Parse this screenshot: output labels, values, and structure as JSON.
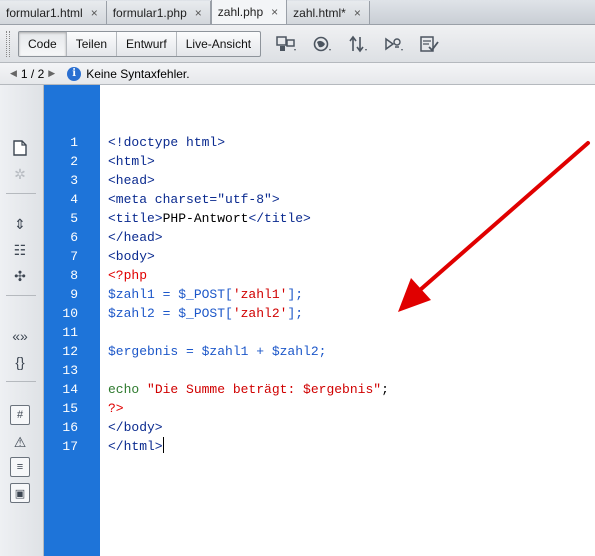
{
  "tabs": [
    {
      "label": "formular1.html",
      "close": "×",
      "active": false
    },
    {
      "label": "formular1.php",
      "close": "×",
      "active": false
    },
    {
      "label": "zahl.php",
      "close": "×",
      "active": true
    },
    {
      "label": "zahl.html*",
      "close": "×",
      "active": false
    }
  ],
  "toolbar": {
    "views": [
      "Code",
      "Teilen",
      "Entwurf",
      "Live-Ansicht"
    ],
    "active_view": "Code",
    "tools": [
      "multiscreen-icon",
      "globe-icon",
      "file-transfer-icon",
      "preview-icon",
      "validate-icon"
    ]
  },
  "nav": {
    "page": "1 / 2",
    "status": "Keine Syntaxfehler."
  },
  "editor": {
    "line_numbers": [
      "1",
      "2",
      "3",
      "4",
      "5",
      "6",
      "7",
      "8",
      "9",
      "10",
      "11",
      "12",
      "13",
      "14",
      "15",
      "16",
      "17"
    ],
    "lines": [
      [
        {
          "t": "<!doctype html>",
          "c": "tag"
        }
      ],
      [
        {
          "t": "<html>",
          "c": "tag"
        }
      ],
      [
        {
          "t": "<head>",
          "c": "tag"
        }
      ],
      [
        {
          "t": "<meta charset=\"utf-8\">",
          "c": "tag"
        }
      ],
      [
        {
          "t": "<title>",
          "c": "tag"
        },
        {
          "t": "PHP-Antwort",
          "c": "plain"
        },
        {
          "t": "</title>",
          "c": "tag"
        }
      ],
      [
        {
          "t": "</head>",
          "c": "tag"
        }
      ],
      [
        {
          "t": "<body>",
          "c": "tag"
        }
      ],
      [
        {
          "t": "<?php",
          "c": "php"
        }
      ],
      [
        {
          "t": "$zahl1 = $_POST[",
          "c": "var"
        },
        {
          "t": "'zahl1'",
          "c": "str"
        },
        {
          "t": "];",
          "c": "var"
        }
      ],
      [
        {
          "t": "$zahl2 = $_POST[",
          "c": "var"
        },
        {
          "t": "'zahl2'",
          "c": "str"
        },
        {
          "t": "];",
          "c": "var"
        }
      ],
      [],
      [
        {
          "t": "$ergebnis = $zahl1 + $zahl2;",
          "c": "var"
        }
      ],
      [],
      [
        {
          "t": "echo ",
          "c": "kw"
        },
        {
          "t": "\"Die Summe beträgt: $ergebnis\"",
          "c": "str"
        },
        {
          "t": ";",
          "c": "plain"
        }
      ],
      [
        {
          "t": "?>",
          "c": "php"
        }
      ],
      [
        {
          "t": "</body>",
          "c": "tag"
        }
      ],
      [
        {
          "t": "</html>",
          "c": "tag"
        }
      ]
    ]
  },
  "sidebar": {
    "icons": [
      "open-documents-icon",
      "collapse-icon",
      "collapse-tag-icon",
      "collapse-selection-icon",
      "expand-all-icon",
      "select-parent-tag-icon",
      "balance-braces-icon",
      "line-numbers-icon",
      "highlight-invalid-code-icon",
      "apply-comment-icon",
      "wrap-tag-icon",
      "recent-snippets-icon"
    ]
  },
  "colors": {
    "gutter": "#1e74d9",
    "annotation_arrow": "#e00000",
    "html_tag": "#0a2a8f",
    "php_variable": "#1c57c9",
    "string": "#d00000"
  }
}
